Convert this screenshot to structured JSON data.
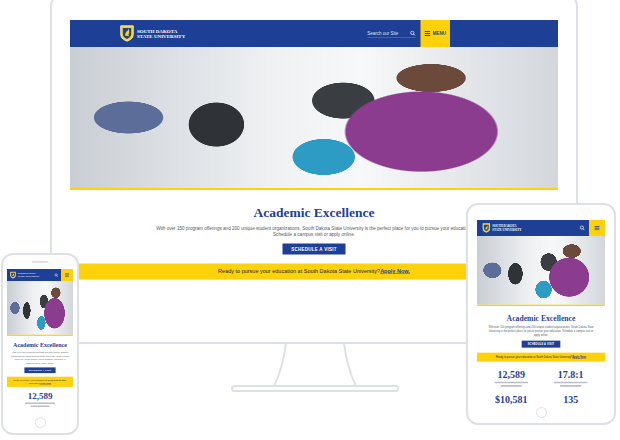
{
  "devices": [
    {
      "kind": "desktop",
      "header": {
        "logo": [
          "SOUTH DAKOTA",
          "STATE UNIVERSITY"
        ],
        "search_placeholder": "Search our Site",
        "menu_label": "MENU"
      },
      "hero": {
        "title": "Academic Excellence",
        "text": "With over 150 program offerings and 200 unique student organizations, South Dakota State University is the perfect place for you to pursue your education. Schedule a campus visit or apply online.",
        "button": "SCHEDULE A VISIT"
      },
      "banner": {
        "text": "Ready to pursue your education at South Dakota State University?",
        "link": "Apply Now."
      },
      "stats": []
    },
    {
      "kind": "tablet",
      "header": {
        "logo": [
          "SOUTH DAKOTA",
          "STATE UNIVERSITY"
        ]
      },
      "hero": {
        "title": "Academic Excellence",
        "text": "With over 150 program offerings and 200 unique student organizations, South Dakota State University is the perfect place for you to pursue your education. Schedule a campus visit or apply online.",
        "button": "SCHEDULE A VISIT"
      },
      "banner": {
        "text": "Ready to pursue your education at South Dakota State University?",
        "link": "Apply Now."
      },
      "stats": [
        {
          "value": "12,589"
        },
        {
          "value": "17.8:1"
        },
        {
          "value": "$10,581"
        },
        {
          "value": "135"
        }
      ]
    },
    {
      "kind": "phone",
      "header": {
        "logo": [
          "SOUTH DAKOTA",
          "STATE UNIVERSITY"
        ]
      },
      "hero": {
        "title": "Academic Excellence",
        "text": "With over 150 program offerings and 200 unique student organizations, South Dakota State University is the perfect place for you to pursue your education. Schedule a campus visit or apply online.",
        "button": "SCHEDULE A VISIT"
      },
      "banner": {
        "text": "Ready to pursue your education at South Dakota State University?",
        "link": "Apply Now."
      },
      "stats": [
        {
          "value": "12,589"
        }
      ]
    }
  ]
}
